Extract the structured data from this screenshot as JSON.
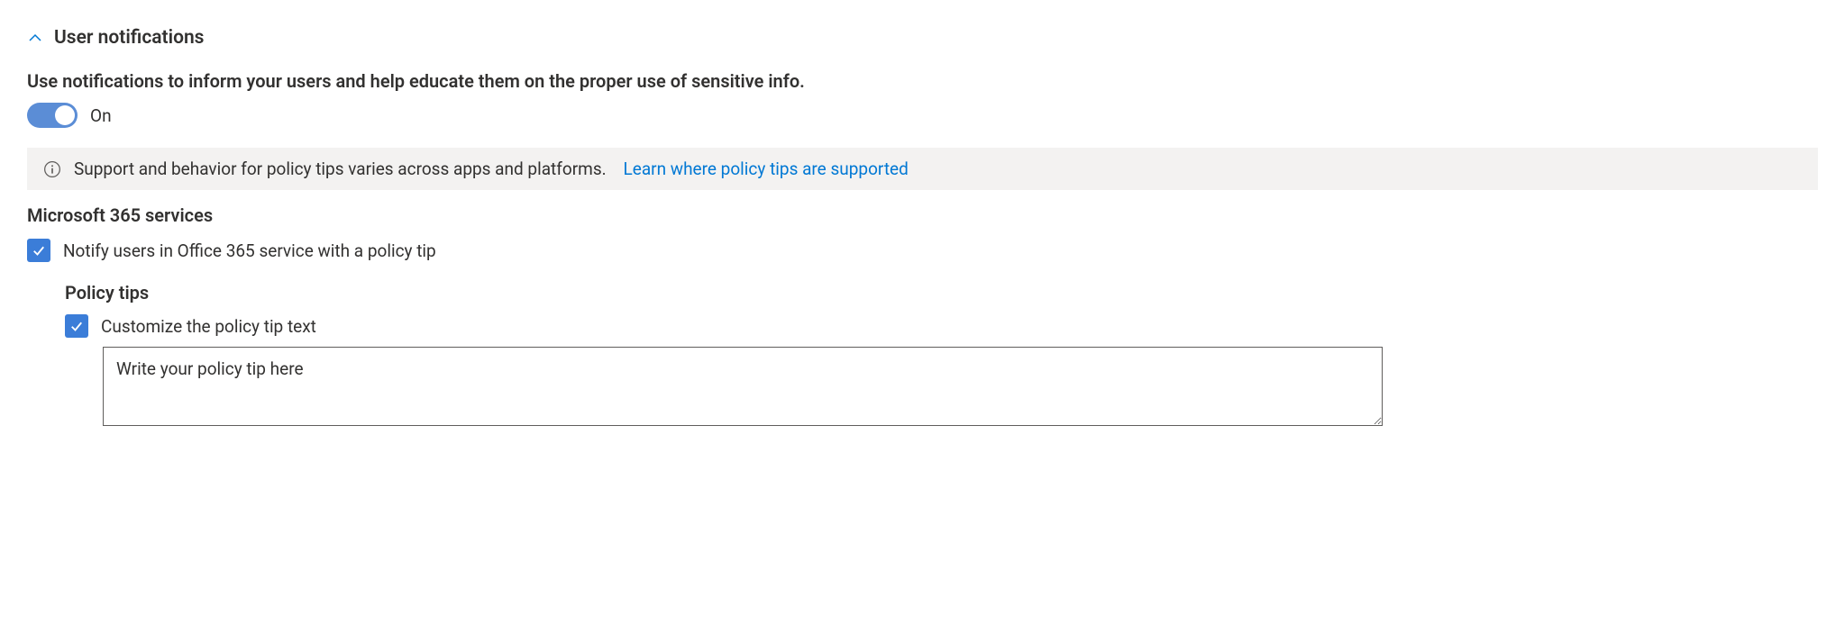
{
  "section": {
    "title": "User notifications",
    "description": "Use notifications to inform your users and help educate them on the proper use of sensitive info."
  },
  "toggle": {
    "state_label": "On"
  },
  "info_banner": {
    "text": "Support and behavior for policy tips varies across apps and platforms.",
    "link_text": "Learn where policy tips are supported"
  },
  "subsection": {
    "title": "Microsoft 365 services",
    "notify_checkbox_label": "Notify users in Office 365 service with a policy tip"
  },
  "policy_tips": {
    "title": "Policy tips",
    "customize_checkbox_label": "Customize the policy tip text",
    "textarea_prefix": "Write your policy tip ",
    "textarea_underlined": "here"
  }
}
